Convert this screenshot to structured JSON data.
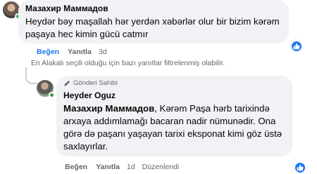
{
  "comment": {
    "author": "Мазахир Маммадов",
    "text": "Heydər bəy maşallah hər yerdən xəbərlər olur bir bizim kərəm paşaya hec kimin gücü catmır",
    "actions": {
      "like": "Beğen",
      "reply": "Yanıtla",
      "time": "3d"
    },
    "reaction_icon": "thumbs-up-icon"
  },
  "filter_note": "En Alakalı seçili olduğu için bazı yanıtlar filtrelenmiş olabilir.",
  "reply": {
    "badge": "Gönderi Sahibi",
    "author": "Heyder Oguz",
    "mention": "Мазахир Маммадов",
    "text": ", Kərəm Paşa hərb tarixində arxaya addımlamağı bacaran nadir nümunədir. Ona görə də paşanı yaşayan tarixi eksponat kimi göz üstə saxlayırlar.",
    "actions": {
      "like": "Beğen",
      "reply": "Yanıtla",
      "time": "1d",
      "edited": "Düzenlendi"
    },
    "reaction_icon": "thumbs-up-icon"
  },
  "colors": {
    "accent": "#1877f2",
    "bubble": "#f0f2f5",
    "muted": "#65676b",
    "online": "#31a24c"
  }
}
